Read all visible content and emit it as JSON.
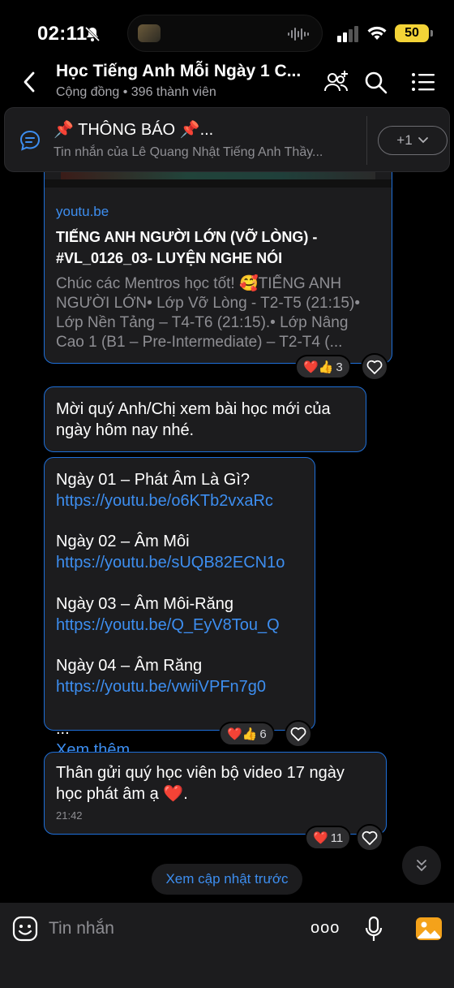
{
  "status_bar": {
    "time": "02:11",
    "battery": "50"
  },
  "header": {
    "title": "Học Tiếng Anh Mỗi Ngày 1 C...",
    "subtitle": "Cộng đồng • 396 thành viên"
  },
  "pinned": {
    "title": "📌 THÔNG BÁO 📌...",
    "subtitle": "Tin nhắn của Lê Quang Nhật Tiếng Anh Thầy...",
    "count": "+1"
  },
  "link_card": {
    "domain": "youtu.be",
    "title": "TIẾNG ANH NGƯỜI LỚN (VỠ LÒNG) - #VL_0126_03- LUYỆN NGHE NÓI",
    "description": "Chúc các Mentros học tốt! 🥰TIẾNG ANH NGƯỜI LỚN• Lớp Vỡ Lòng - T2-T5 (21:15)• Lớp Nền Tảng – T4-T6 (21:15).• Lớp Nâng Cao 1 (B1 – Pre-Intermediate) – T2-T4 (...",
    "reaction_emojis": "❤️👍",
    "reaction_count": "3"
  },
  "message_invite": {
    "text": "Mời quý Anh/Chị xem bài học mới của ngày hôm nay nhé."
  },
  "message_lessons": {
    "items": [
      {
        "title": "Ngày 01 – Phát Âm Là Gì?",
        "link": "https://youtu.be/o6KTb2vxaRc"
      },
      {
        "title": "Ngày 02 – Âm Môi",
        "link": "https://youtu.be/sUQB82ECN1o"
      },
      {
        "title": "Ngày 03 – Âm Môi-Răng",
        "link": "https://youtu.be/Q_EyV8Tou_Q"
      },
      {
        "title": "Ngày 04 – Âm Răng",
        "link": "https://youtu.be/vwiiVPFn7g0"
      }
    ],
    "ellipsis": "...",
    "see_more": "Xem thêm",
    "reaction_emojis": "❤️👍",
    "reaction_count": "6"
  },
  "message_thanks": {
    "text": "Thân gửi quý học viên bộ video  17 ngày học phát âm ạ ❤️.",
    "time": "21:42",
    "reaction_emojis": "❤️",
    "reaction_count": "11"
  },
  "older_button": "Xem cập nhật trước",
  "input": {
    "placeholder": "Tin nhắn",
    "more": "ooo"
  },
  "colors": {
    "accent": "#3d8ef0",
    "bubble_border": "#1e6fd9",
    "bubble_bg": "#1c1c1e",
    "battery": "#f3d337",
    "heart": "#e8203a"
  }
}
